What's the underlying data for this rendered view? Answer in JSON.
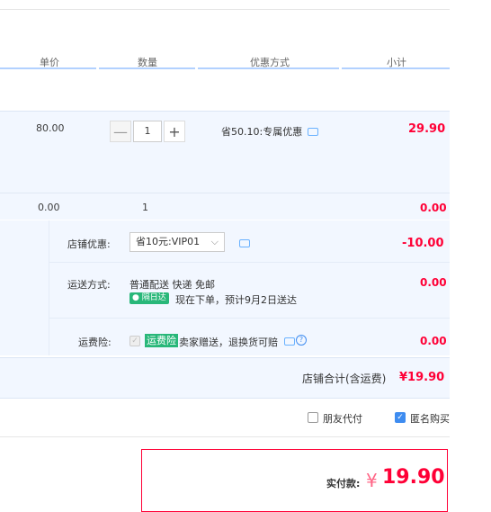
{
  "headers": {
    "unit_price": "单价",
    "quantity": "数量",
    "promotion": "优惠方式",
    "subtotal": "小计"
  },
  "item": {
    "unit_price": "80.00",
    "quantity": "1",
    "minus": "—",
    "plus": "+",
    "promotion": "省50.10:专属优惠",
    "subtotal": "29.90"
  },
  "gift_row": {
    "unit_price": "0.00",
    "quantity": "1",
    "subtotal": "0.00"
  },
  "shop_discount": {
    "label": "店铺优惠:",
    "selected": "省10元:VIP01",
    "amount": "-10.00"
  },
  "shipping": {
    "label": "运送方式:",
    "method": "普通配送 快递 免邮",
    "badge": "隔日达",
    "note": "现在下单，预计9月2日送达",
    "amount": "0.00"
  },
  "insurance": {
    "label": "运费险:",
    "badge": "运费险",
    "text": "卖家赠送，退换货可赔",
    "amount": "0.00"
  },
  "shop_total": {
    "label": "店铺合计(含运费)",
    "amount": "¥19.90"
  },
  "options": {
    "friend_pay": "朋友代付",
    "anonymous": "匿名购买"
  },
  "payment": {
    "label": "实付款:",
    "currency": "¥",
    "amount": "19.90"
  },
  "colors": {
    "accent_red": "#ff0036",
    "band_bg": "#f2f7ff",
    "header_line": "#b2d1ff",
    "green_badge": "#28b779"
  }
}
